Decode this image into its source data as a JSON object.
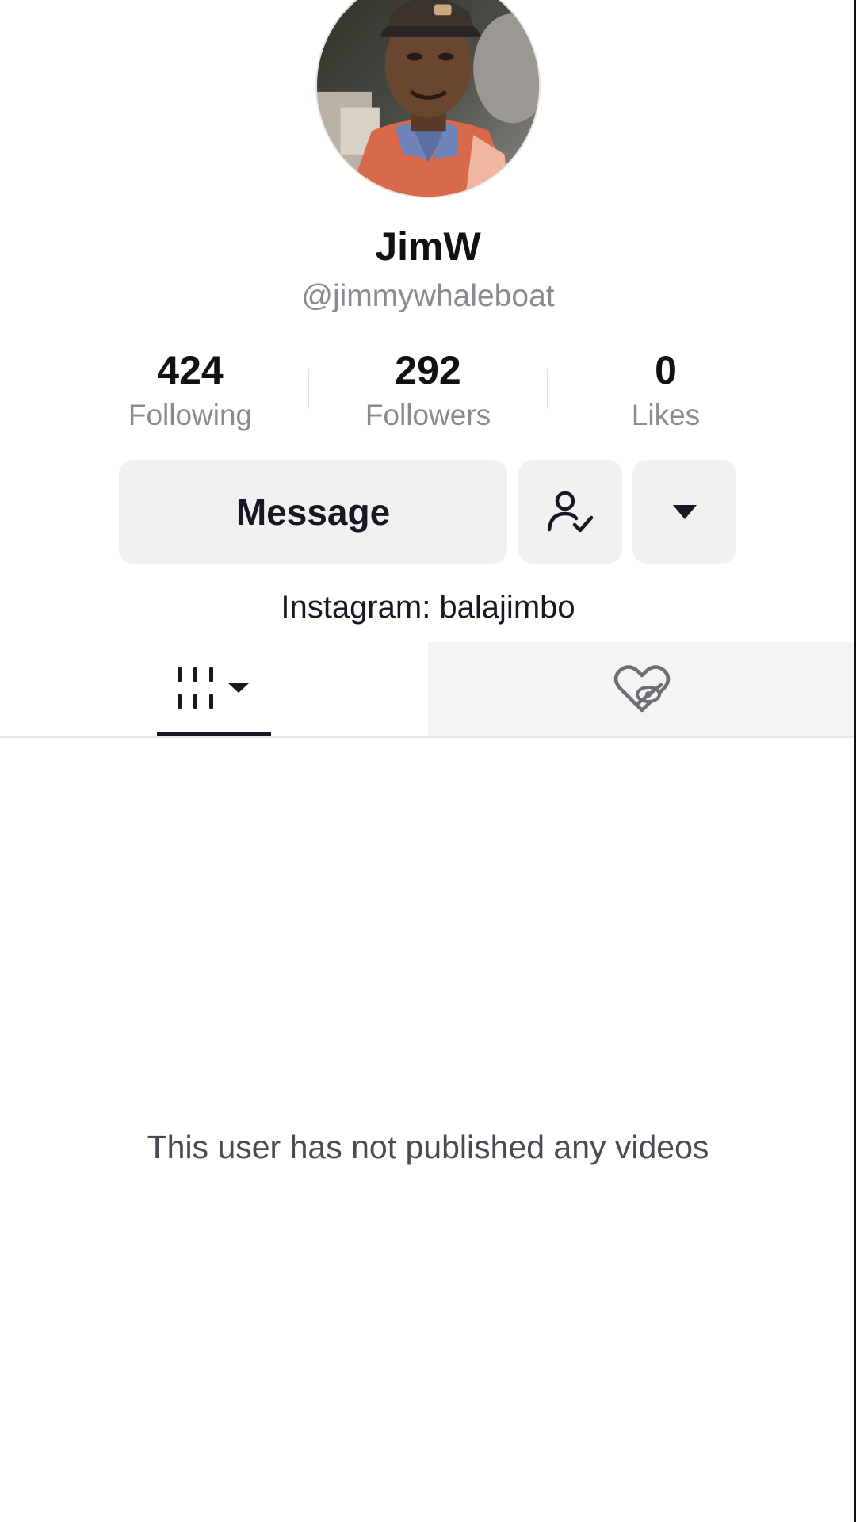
{
  "profile": {
    "display_name": "JimW",
    "username": "@jimmywhaleboat",
    "avatar_icon": "profile-photo",
    "bio": "Instagram: balajimbo"
  },
  "stats": [
    {
      "value": "424",
      "label": "Following"
    },
    {
      "value": "292",
      "label": "Followers"
    },
    {
      "value": "0",
      "label": "Likes"
    }
  ],
  "actions": {
    "message_label": "Message",
    "friends_icon": "user-check-icon",
    "more_icon": "caret-down-icon"
  },
  "tabs": {
    "videos_icon": "grid-icon",
    "liked_icon": "hidden-heart-icon",
    "active": "videos"
  },
  "content": {
    "empty_message": "This user has not published any videos"
  },
  "colors": {
    "text_primary": "#161823",
    "text_secondary": "#8a8b91",
    "button_bg": "#f1f1f2"
  }
}
